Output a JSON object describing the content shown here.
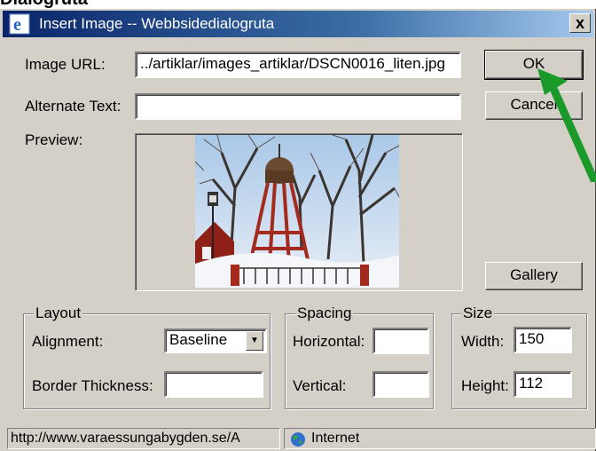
{
  "page_header": "Dialogruta",
  "window": {
    "title": "Insert Image -- Webbsidedialogruta",
    "close_label": "x"
  },
  "form": {
    "image_url_label": "Image URL:",
    "image_url_value": "../artiklar/images_artiklar/DSCN0016_liten.jpg",
    "alt_text_label": "Alternate Text:",
    "alt_text_value": "",
    "preview_label": "Preview:"
  },
  "buttons": {
    "ok": "OK",
    "cancel": "Cancel",
    "gallery": "Gallery"
  },
  "layout_group": {
    "legend": "Layout",
    "alignment_label": "Alignment:",
    "alignment_value": "Baseline",
    "border_label": "Border Thickness:",
    "border_value": ""
  },
  "spacing_group": {
    "legend": "Spacing",
    "horizontal_label": "Horizontal:",
    "horizontal_value": "",
    "vertical_label": "Vertical:",
    "vertical_value": ""
  },
  "size_group": {
    "legend": "Size",
    "width_label": "Width:",
    "width_value": "150",
    "height_label": "Height:",
    "height_value": "112"
  },
  "status_bar": {
    "url": "http://www.varaessungabygden.se/A",
    "zone": "Internet"
  },
  "icons": {
    "title_icon": "ie-icon",
    "zone_icon": "globe-icon",
    "annotation": "green-arrow"
  },
  "colors": {
    "titlebar_start": "#0a246a",
    "titlebar_end": "#a6caf0",
    "dialog_face": "#d4d0c8",
    "annotation_arrow": "#1a9a2a"
  }
}
